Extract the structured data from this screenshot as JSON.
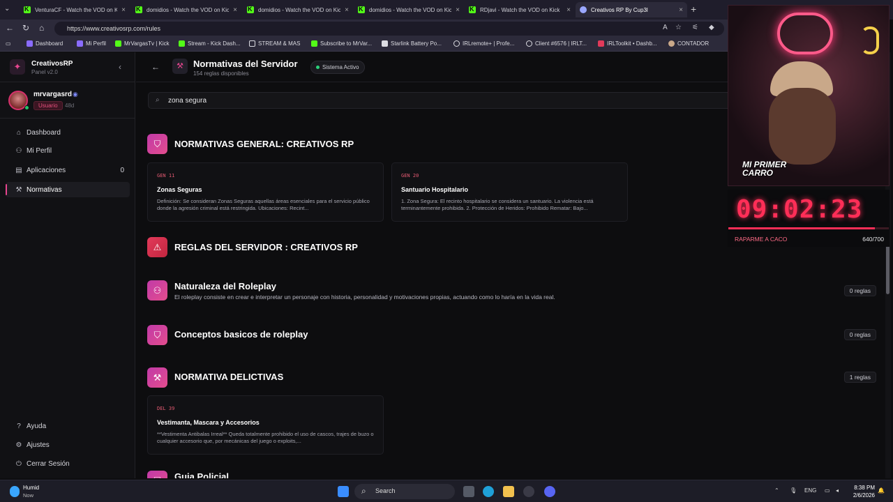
{
  "browser": {
    "tabs": [
      {
        "title": "VenturaCF - Watch the VOD on Kick"
      },
      {
        "title": "domidios - Watch the VOD on Kick"
      },
      {
        "title": "domidios - Watch the VOD on Kick"
      },
      {
        "title": "domidios - Watch the VOD on Kick"
      },
      {
        "title": "RDjavi - Watch the VOD on Kick"
      },
      {
        "title": "Creativos RP By Cup3l"
      }
    ],
    "url": "https://www.creativosrp.com/rules",
    "bookmarks": [
      {
        "label": "Dashboard",
        "color": "#8a6cff"
      },
      {
        "label": "Mi Perfil",
        "color": "#8a6cff"
      },
      {
        "label": "MrVargasTv | Kick",
        "color": "#53fc18"
      },
      {
        "label": "Stream - Kick Dash...",
        "color": "#53fc18"
      },
      {
        "label": "STREAM & MAS",
        "color": "#dcdce2"
      },
      {
        "label": "Subscribe to MrVar...",
        "color": "#53fc18"
      },
      {
        "label": "Starlink Battery Po...",
        "color": "#dcdce2"
      },
      {
        "label": "IRLremote+ | Profe...",
        "color": "#dcdce2"
      },
      {
        "label": "Client #6576 | IRLT...",
        "color": "#dcdce2"
      },
      {
        "label": "IRLToolkit • Dashb...",
        "color": "#e23a5a"
      },
      {
        "label": "CONTADOR",
        "color": "#c9a889"
      }
    ]
  },
  "sidebar": {
    "brand": "CreativosRP",
    "version": "Panel v2.0",
    "user": {
      "name": "mrvargasrd",
      "role": "Usuario",
      "age": "48d"
    },
    "nav": [
      {
        "label": "Dashboard",
        "icon": "home-icon",
        "glyph": "⌂"
      },
      {
        "label": "Mi Perfil",
        "icon": "user-icon",
        "glyph": "👤"
      },
      {
        "label": "Aplicaciones",
        "icon": "document-icon",
        "glyph": "▤",
        "count": "0"
      },
      {
        "label": "Normativas",
        "icon": "gavel-icon",
        "glyph": "⚒"
      }
    ],
    "footer": [
      {
        "label": "Ayuda",
        "icon": "help-icon",
        "glyph": "?"
      },
      {
        "label": "Ajustes",
        "icon": "gear-icon",
        "glyph": "⚙"
      },
      {
        "label": "Cerrar Sesión",
        "icon": "logout-icon",
        "glyph": "⏻"
      }
    ]
  },
  "main": {
    "title": "Normativas del Servidor",
    "subtitle": "154 reglas disponibles",
    "status": "Sistema Activo",
    "search_value": "zona segura",
    "sections": [
      {
        "title": "NORMATIVAS GENERAL: CREATIVOS RP",
        "icon": "shield-icon",
        "glyph": "⛉"
      },
      {
        "title": "REGLAS DEL SERVIDOR : CREATIVOS RP",
        "icon": "siren-icon",
        "glyph": "⚠"
      },
      {
        "title": "Naturaleza del Roleplay",
        "icon": "users-icon",
        "glyph": "👥",
        "desc": "El roleplay consiste en crear e interpretar un personaje con historia, personalidad y motivaciones propias, actuando como lo haría en la vida real.",
        "count": "0 reglas"
      },
      {
        "title": "Conceptos basicos de roleplay",
        "icon": "shield-icon",
        "glyph": "⛉",
        "count": "0 reglas"
      },
      {
        "title": "NORMATIVA DELICTIVAS",
        "icon": "gavel-icon",
        "glyph": "⚒",
        "count": "1 reglas"
      },
      {
        "title": "Guia Policial",
        "icon": "badge-icon",
        "glyph": "⛉"
      }
    ],
    "cards": [
      {
        "code": "GEN 11",
        "title": "Zonas Seguras",
        "desc": "Definición: Se consideran Zonas Seguras aquellas áreas esenciales para el servicio público donde la agresión criminal está restringida. Ubicaciones: Recint..."
      },
      {
        "code": "GEN 20",
        "title": "Santuario Hospitalario",
        "desc": "1. Zona Segura: El recinto hospitalario se considera un santuario. La violencia está terminantemente prohibida. 2. Protección de Heridos: Prohibido Rematar: Bajo..."
      },
      {
        "code": "DEL 39",
        "title": "Vestimanta, Mascara y Accesorios",
        "desc": "**Vestimenta Antibalas Irreal** Queda totalmente prohibido el uso de cascos, trajes de buzo o cualquier accesorio que, por mecánicas del juego o exploits,..."
      }
    ]
  },
  "overlay": {
    "label_line1": "MI PRIMER",
    "label_line2": "CARRO",
    "timer": "09:02:23",
    "goal_text": "RAPARME A CACO",
    "goal_count": "640/700",
    "progress": 0.914
  },
  "taskbar": {
    "weather": "Humid",
    "weather_sub": "Now",
    "search": "Search",
    "lang": "ENG",
    "time": "8:38 PM",
    "date": "2/6/2026"
  }
}
